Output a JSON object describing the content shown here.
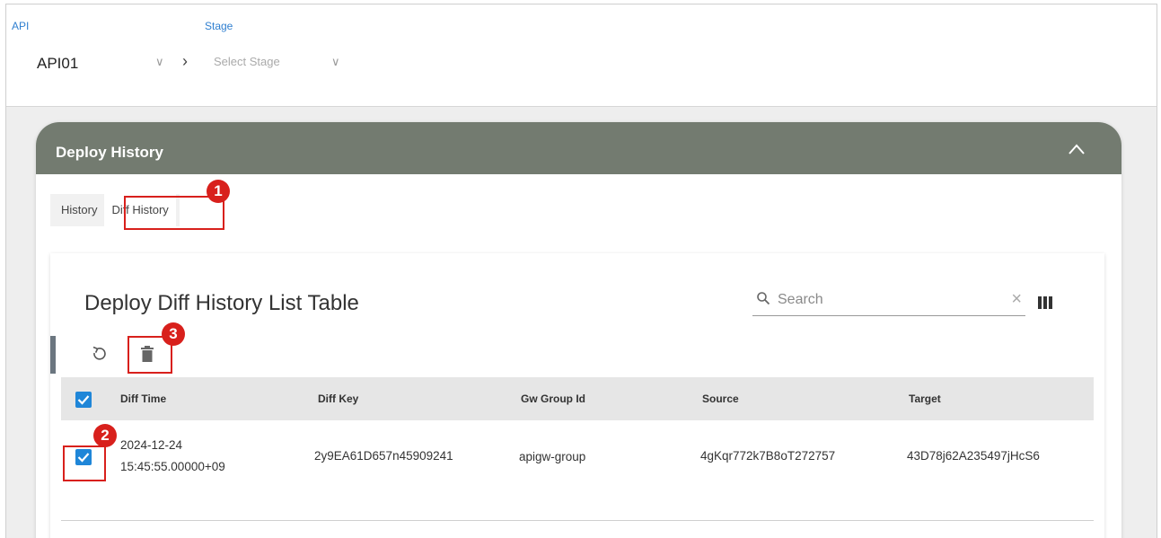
{
  "topbar": {
    "api_label": "API",
    "api_value": "API01",
    "stage_label": "Stage",
    "stage_placeholder": "Select Stage"
  },
  "card": {
    "title": "Deploy History",
    "tabs": [
      {
        "label": "History",
        "active": false
      },
      {
        "label": "Diff History",
        "active": true
      }
    ]
  },
  "table": {
    "title": "Deploy Diff History List Table",
    "search_placeholder": "Search",
    "columns": [
      "Diff Time",
      "Diff Key",
      "Gw Group Id",
      "Source",
      "Target"
    ],
    "rows": [
      {
        "checked": true,
        "diff_time_date": "2024-12-24",
        "diff_time_time": "15:45:55.00000+09",
        "diff_key": "2y9EA61D657n45909241",
        "gw_group_id": "apigw-group",
        "source": "4gKqr772k7B8oT272757",
        "target": "43D78j62A235497jHcS6"
      }
    ],
    "header_checked": true
  },
  "callouts": [
    "1",
    "2",
    "3"
  ],
  "colors": {
    "accent": "#737b70",
    "callout": "#d8201c",
    "checkbox": "#1f86d8",
    "link_label": "#2f7fd0"
  },
  "icons": [
    "chevron-down-icon",
    "breadcrumb-arrow-icon",
    "collapse-icon",
    "search-icon",
    "clear-icon",
    "columns-icon",
    "refresh-icon",
    "delete-icon",
    "checkbox-icon"
  ]
}
